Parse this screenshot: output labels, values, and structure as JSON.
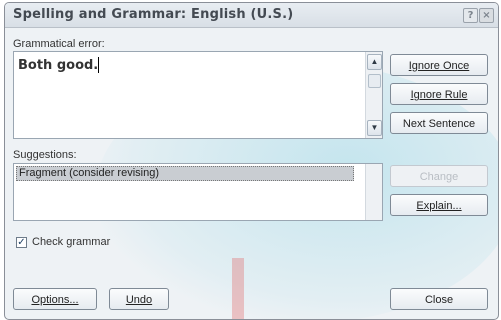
{
  "window": {
    "title": "Spelling and Grammar: English (U.S.)",
    "help_glyph": "?",
    "close_glyph": "×"
  },
  "error_section": {
    "label": "Grammatical error:",
    "text": "Both good."
  },
  "suggestions_section": {
    "label": "Suggestions:",
    "items": [
      "Fragment (consider revising)"
    ]
  },
  "buttons": {
    "ignore_once": "Ignore Once",
    "ignore_rule": "Ignore Rule",
    "next_sentence": "Next Sentence",
    "change": "Change",
    "explain": "Explain...",
    "options": "Options...",
    "undo": "Undo",
    "close": "Close"
  },
  "check_grammar": {
    "label": "Check grammar",
    "checked": true
  },
  "icons": {
    "scroll_up": "▲",
    "scroll_down": "▼",
    "check": "✓"
  }
}
